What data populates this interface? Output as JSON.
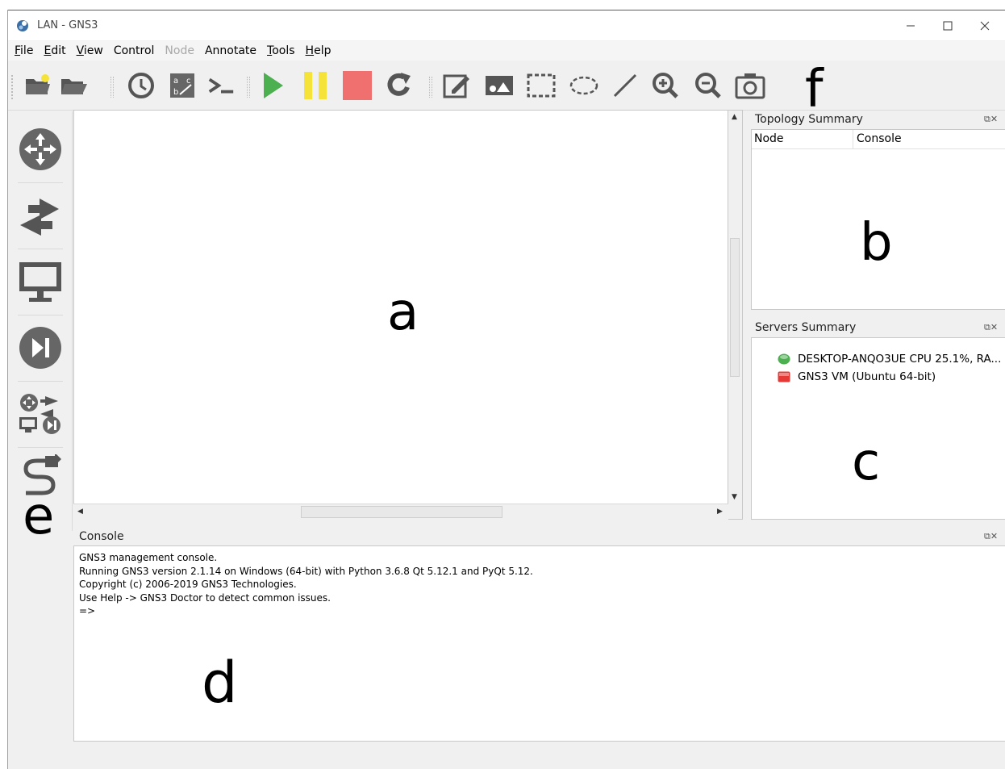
{
  "window": {
    "title": "LAN - GNS3"
  },
  "menu": [
    {
      "label": "File",
      "underline": "F",
      "rest": "ile",
      "disabled": false
    },
    {
      "label": "Edit",
      "underline": "E",
      "rest": "dit",
      "disabled": false
    },
    {
      "label": "View",
      "underline": "V",
      "rest": "iew",
      "disabled": false
    },
    {
      "label": "Control",
      "underline": "",
      "rest": "Control",
      "disabled": false
    },
    {
      "label": "Node",
      "underline": "",
      "rest": "Node",
      "disabled": true
    },
    {
      "label": "Annotate",
      "underline": "",
      "rest": "Annotate",
      "disabled": false
    },
    {
      "label": "Tools",
      "underline": "T",
      "rest": "ools",
      "disabled": false
    },
    {
      "label": "Help",
      "underline": "H",
      "rest": "elp",
      "disabled": false
    }
  ],
  "toolbar": {
    "icons": [
      "new-project-icon",
      "open-project-icon",
      "snapshot-clock-icon",
      "show-interface-labels-icon",
      "console-all-icon",
      "start-all-icon",
      "suspend-all-icon",
      "stop-all-icon",
      "reload-all-icon",
      "add-note-icon",
      "insert-image-icon",
      "draw-rectangle-icon",
      "draw-ellipse-icon",
      "draw-line-icon",
      "zoom-in-icon",
      "zoom-out-icon",
      "screenshot-icon"
    ]
  },
  "labels": {
    "a": "a",
    "b": "b",
    "c": "c",
    "d": "d",
    "e": "e",
    "f": "f"
  },
  "devices": [
    "routers-icon",
    "switches-icon",
    "end-devices-icon",
    "security-devices-icon",
    "all-devices-icon",
    "add-link-icon"
  ],
  "topology": {
    "title": "Topology Summary",
    "col_node": "Node",
    "col_console": "Console"
  },
  "servers": {
    "title": "Servers Summary",
    "items": [
      {
        "name": "DESKTOP-ANQO3UE CPU 25.1%, RA...",
        "status_color": "#4caf50"
      },
      {
        "name": "GNS3 VM (Ubuntu 64-bit)",
        "status_color": "#e53935"
      }
    ]
  },
  "console": {
    "title": "Console",
    "lines": [
      "GNS3 management console.",
      "Running GNS3 version 2.1.14 on Windows (64-bit) with Python 3.6.8 Qt 5.12.1 and PyQt 5.12.",
      "Copyright (c) 2006-2019 GNS3 Technologies.",
      "Use Help -> GNS3 Doctor to detect common issues.",
      "",
      "=>"
    ]
  },
  "colors": {
    "accent_green": "#4caf50",
    "pause_yellow": "#f5e33a",
    "stop_red": "#f07070",
    "icon_gray": "#555555"
  }
}
